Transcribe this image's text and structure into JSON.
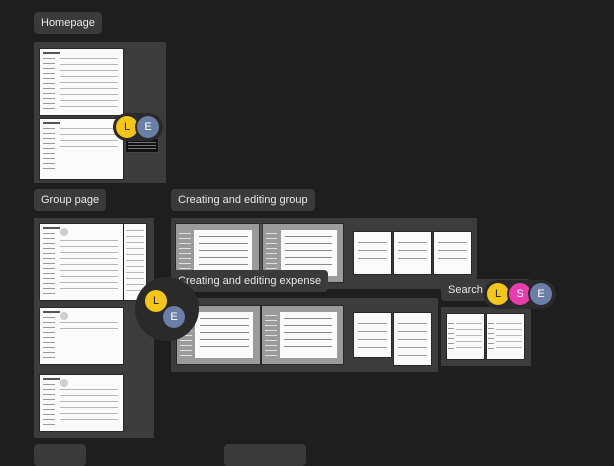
{
  "sections": {
    "homepage": {
      "label": "Homepage"
    },
    "group_page": {
      "label": "Group page"
    },
    "creating_editing_group": {
      "label": "Creating and editing group"
    },
    "creating_editing_expense": {
      "label": "Creating and editing expense"
    },
    "search": {
      "label": "Search"
    }
  },
  "avatars": {
    "homepage": [
      {
        "initial": "L",
        "color": "#f5c518",
        "text_color": "#1e1e1e"
      },
      {
        "initial": "E",
        "color": "#6a7fa8",
        "text_color": "#ffffff"
      }
    ],
    "group_page": [
      {
        "initial": "L",
        "color": "#f5c518",
        "text_color": "#1e1e1e"
      },
      {
        "initial": "E",
        "color": "#6a7fa8",
        "text_color": "#ffffff"
      }
    ],
    "search": [
      {
        "initial": "L",
        "color": "#f5c518",
        "text_color": "#1e1e1e"
      },
      {
        "initial": "S",
        "color": "#e93cac",
        "text_color": "#ffffff"
      },
      {
        "initial": "E",
        "color": "#6a7fa8",
        "text_color": "#ffffff"
      }
    ]
  },
  "colors": {
    "canvas": "#1e1e1e",
    "section_fill": "#3c3c3c",
    "label_fill": "#3a3a3a"
  }
}
